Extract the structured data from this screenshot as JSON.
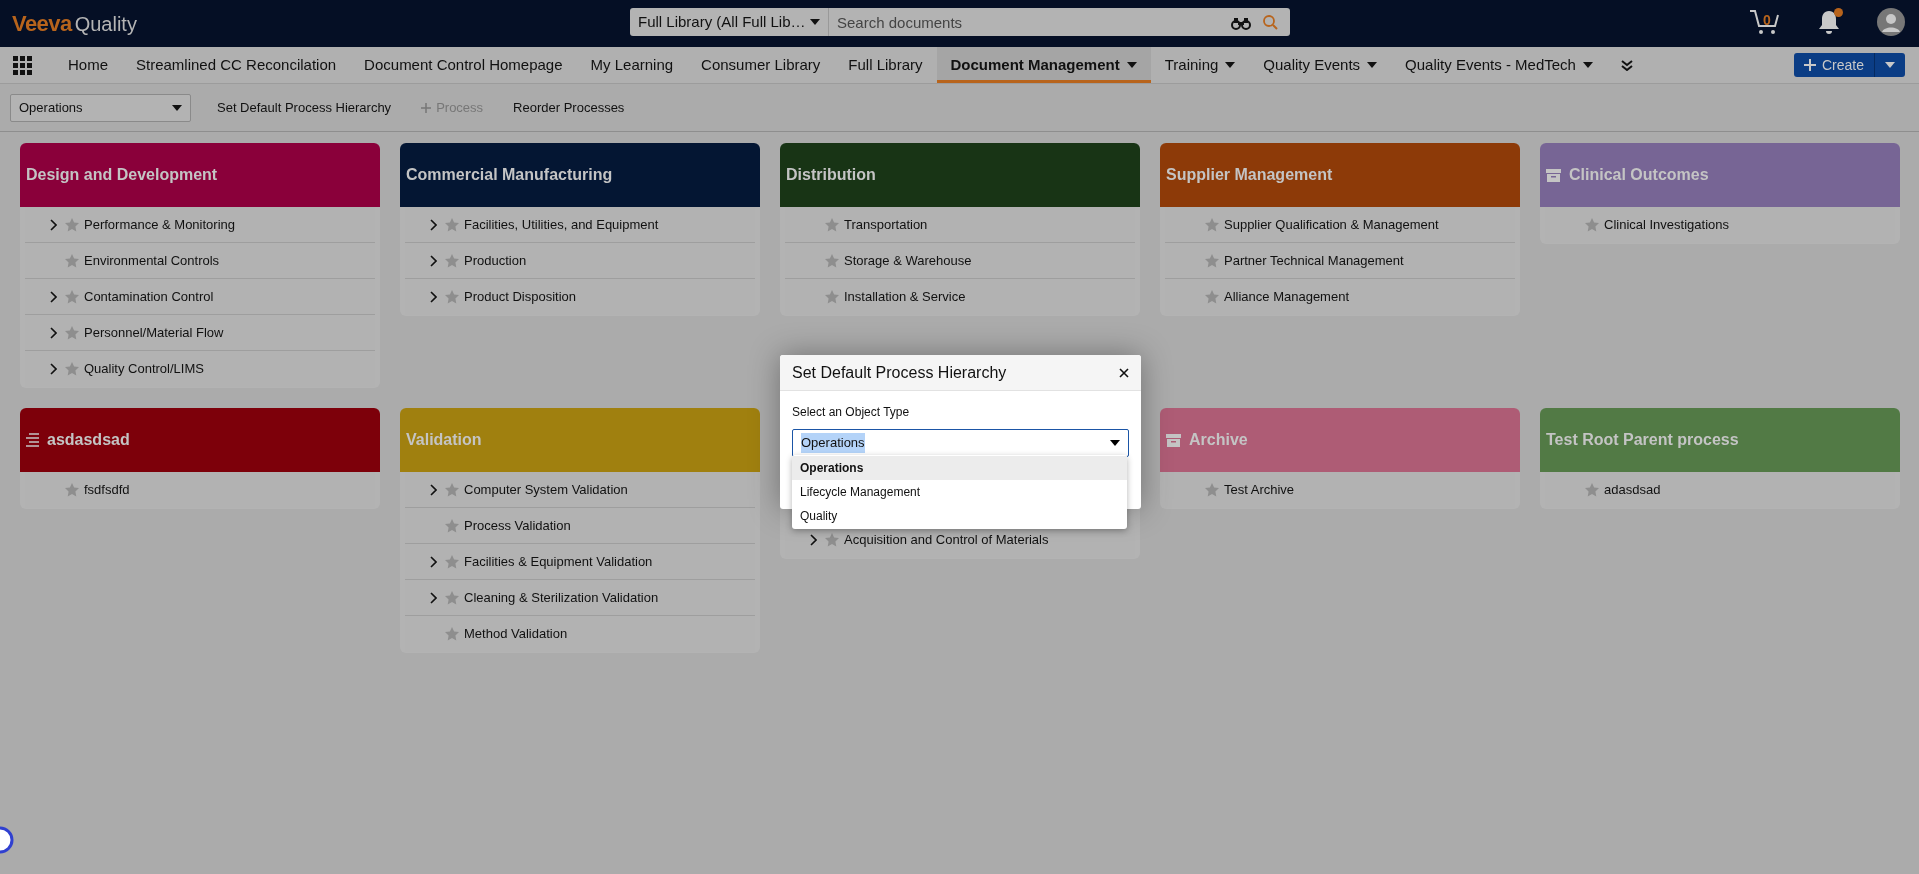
{
  "header": {
    "logo_brand": "Veeva",
    "logo_product": "Quality",
    "library_select": "Full Library (All Full Lib…",
    "search": {
      "placeholder": "Search documents"
    },
    "cart_count": "0",
    "notification": true
  },
  "nav": {
    "tabs": [
      {
        "label": "Home",
        "selected": false,
        "menu": false
      },
      {
        "label": "Streamlined CC Reconcilation",
        "selected": false,
        "menu": false
      },
      {
        "label": "Document Control Homepage",
        "selected": false,
        "menu": false
      },
      {
        "label": "My Learning",
        "selected": false,
        "menu": false
      },
      {
        "label": "Consumer Library",
        "selected": false,
        "menu": false
      },
      {
        "label": "Full Library",
        "selected": false,
        "menu": false
      },
      {
        "label": "Document Management",
        "selected": true,
        "menu": true
      },
      {
        "label": "Training",
        "selected": false,
        "menu": true
      },
      {
        "label": "Quality Events",
        "selected": false,
        "menu": true
      },
      {
        "label": "Quality Events - MedTech",
        "selected": false,
        "menu": true
      }
    ],
    "create_button": "Create"
  },
  "toolbar": {
    "select": "Operations",
    "actions": [
      {
        "label": "Set Default Process Hierarchy",
        "disabled": false,
        "plus": false
      },
      {
        "label": "Process",
        "disabled": true,
        "plus": true
      },
      {
        "label": "Reorder Processes",
        "disabled": false,
        "plus": false
      }
    ]
  },
  "cards": [
    {
      "title": "Design and Development",
      "color": "#8a003a",
      "kind": "plain",
      "items": [
        {
          "label": "Performance & Monitoring",
          "expandable": true
        },
        {
          "label": "Environmental Controls",
          "expandable": false
        },
        {
          "label": "Contamination Control",
          "expandable": true
        },
        {
          "label": "Personnel/Material Flow",
          "expandable": true
        },
        {
          "label": "Quality Control/LIMS",
          "expandable": true
        }
      ]
    },
    {
      "title": "Commercial Manufacturing",
      "color": "#041633",
      "kind": "plain",
      "items": [
        {
          "label": "Facilities, Utilities, and Equipment",
          "expandable": true
        },
        {
          "label": "Production",
          "expandable": true
        },
        {
          "label": "Product Disposition",
          "expandable": true
        }
      ]
    },
    {
      "title": "Distribution",
      "color": "#183415",
      "kind": "plain",
      "items": [
        {
          "label": "Transportation",
          "expandable": false
        },
        {
          "label": "Storage & Warehouse",
          "expandable": false
        },
        {
          "label": "Installation & Service",
          "expandable": false
        }
      ]
    },
    {
      "title": "Supplier Management",
      "color": "#8d3a08",
      "kind": "plain",
      "items": [
        {
          "label": "Supplier Qualification & Management",
          "expandable": false
        },
        {
          "label": "Partner Technical Management",
          "expandable": false
        },
        {
          "label": "Alliance Management",
          "expandable": false
        }
      ]
    },
    {
      "title": "Clinical Outcomes",
      "color": "#776595",
      "kind": "archived",
      "items": [
        {
          "label": "Clinical Investigations",
          "expandable": false
        }
      ]
    },
    {
      "title": "asdasdsad",
      "color": "#7d000a",
      "kind": "list",
      "items": [
        {
          "label": "fsdfsdfd",
          "expandable": false
        }
      ]
    },
    {
      "title": "Validation",
      "color": "#a0800f",
      "kind": "plain",
      "items": [
        {
          "label": "Computer System Validation",
          "expandable": true
        },
        {
          "label": "Process Validation",
          "expandable": false
        },
        {
          "label": "Facilities & Equipment Validation",
          "expandable": true
        },
        {
          "label": "Cleaning & Sterilization Validation",
          "expandable": true
        },
        {
          "label": "Method Validation",
          "expandable": false
        }
      ]
    },
    {
      "kind": "covered",
      "items": [
        {
          "label": "Acquisition and Control of Materials",
          "expandable": true
        }
      ]
    },
    {
      "title": "Archive",
      "color": "#ae5c75",
      "kind": "archived",
      "items": [
        {
          "label": "Test Archive",
          "expandable": false
        }
      ]
    },
    {
      "title": "Test Root Parent process",
      "color": "#527a45",
      "kind": "plain",
      "items": [
        {
          "label": "adasdsad",
          "expandable": false
        }
      ]
    }
  ],
  "modal": {
    "title": "Set Default Process Hierarchy",
    "field_label": "Select an Object Type",
    "value": "Operations",
    "options": [
      {
        "label": "Operations",
        "selected": true
      },
      {
        "label": "Lifecycle Management",
        "selected": false
      },
      {
        "label": "Quality",
        "selected": false
      }
    ]
  }
}
